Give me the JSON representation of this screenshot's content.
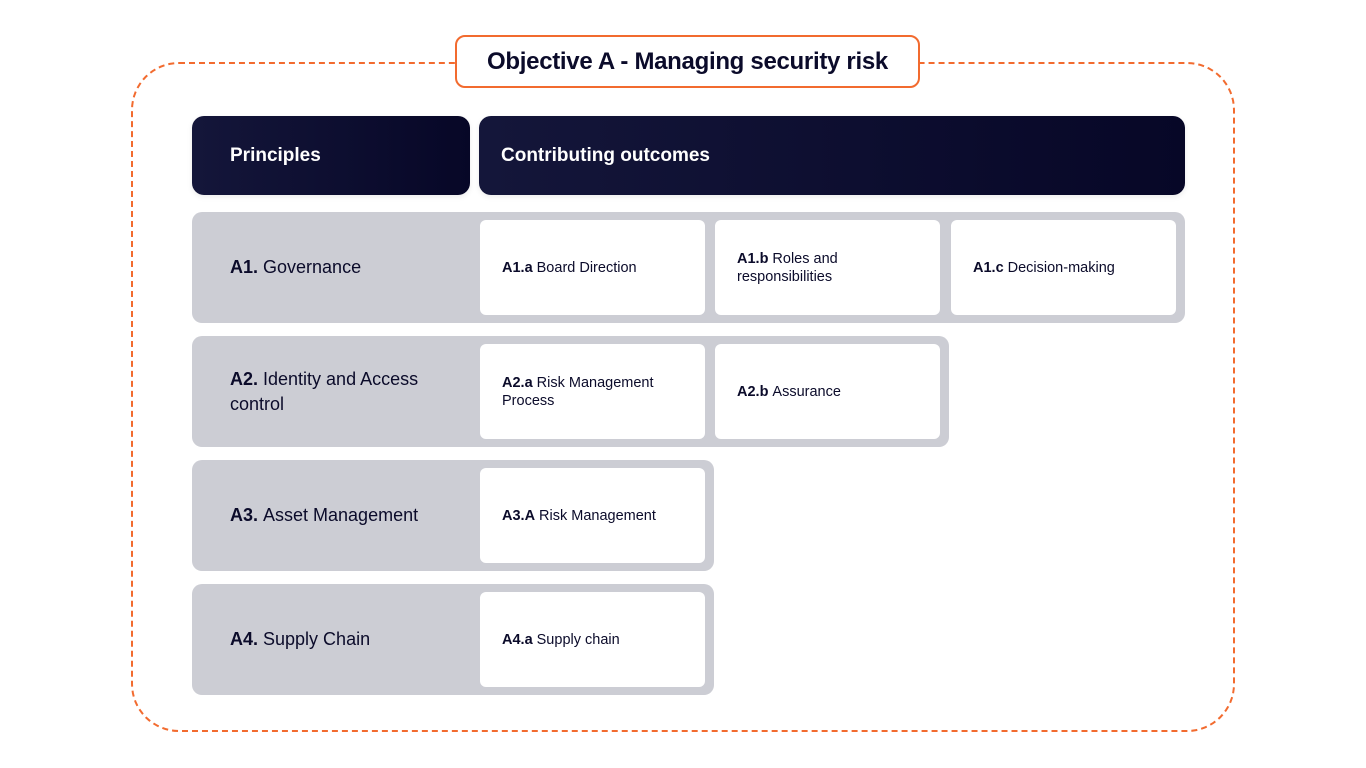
{
  "title": "Objective A - Managing security risk",
  "headers": {
    "principles": "Principles",
    "outcomes": "Contributing outcomes"
  },
  "colors": {
    "accent": "#f26b2f",
    "header_bg": "#0b0b2a",
    "row_bg": "#cccdd4",
    "card_bg": "#ffffff"
  },
  "principles": [
    {
      "code": "A1.",
      "name": "Governance",
      "outcomes": [
        {
          "code": "A1.a",
          "name": "Board Direction"
        },
        {
          "code": "A1.b",
          "name": "Roles and responsibilities"
        },
        {
          "code": "A1.c",
          "name": "Decision-making"
        }
      ]
    },
    {
      "code": "A2.",
      "name": "Identity and Access control",
      "outcomes": [
        {
          "code": "A2.a",
          "name": "Risk Management Process"
        },
        {
          "code": "A2.b",
          "name": "Assurance"
        }
      ]
    },
    {
      "code": "A3.",
      "name": "Asset Management",
      "outcomes": [
        {
          "code": "A3.A",
          "name": "Risk Management"
        }
      ]
    },
    {
      "code": "A4.",
      "name": "Supply Chain",
      "outcomes": [
        {
          "code": "A4.a",
          "name": "Supply chain"
        }
      ]
    }
  ]
}
